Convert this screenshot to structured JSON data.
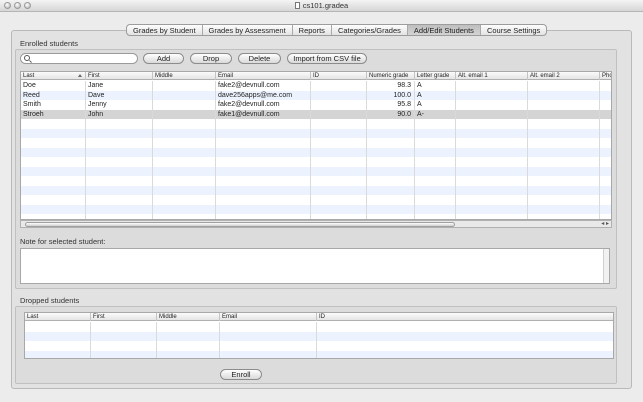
{
  "window": {
    "title": "cs101.gradea"
  },
  "tabs": [
    {
      "label": "Grades by Student",
      "active": false
    },
    {
      "label": "Grades by Assessment",
      "active": false
    },
    {
      "label": "Reports",
      "active": false
    },
    {
      "label": "Categories/Grades",
      "active": false
    },
    {
      "label": "Add/Edit Students",
      "active": true
    },
    {
      "label": "Course Settings",
      "active": false
    }
  ],
  "enrolled": {
    "label": "Enrolled students",
    "search": {
      "value": "",
      "placeholder": ""
    },
    "buttons": {
      "add": "Add",
      "drop": "Drop",
      "delete": "Delete",
      "import": "Import from CSV file"
    },
    "columns": [
      "Last",
      "First",
      "Middle",
      "Email",
      "ID",
      "Numeric grade",
      "Letter grade",
      "Alt. email 1",
      "Alt. email 2",
      "Pho"
    ],
    "rows": [
      {
        "last": "Doe",
        "first": "Jane",
        "middle": "",
        "email": "fake2@devnull.com",
        "id": "",
        "numeric": "98.3",
        "letter": "A",
        "selected": false
      },
      {
        "last": "Reed",
        "first": "Dave",
        "middle": "",
        "email": "dave256apps@me.com",
        "id": "",
        "numeric": "100.0",
        "letter": "A",
        "selected": false
      },
      {
        "last": "Smith",
        "first": "Jenny",
        "middle": "",
        "email": "fake2@devnull.com",
        "id": "",
        "numeric": "95.8",
        "letter": "A",
        "selected": false
      },
      {
        "last": "Stroeh",
        "first": "John",
        "middle": "",
        "email": "fake1@devnull.com",
        "id": "",
        "numeric": "90.0",
        "letter": "A-",
        "selected": true
      }
    ],
    "note_label": "Note for selected student:",
    "note_value": ""
  },
  "dropped": {
    "label": "Dropped students",
    "columns": [
      "Last",
      "First",
      "Middle",
      "Email",
      "ID"
    ],
    "enroll_label": "Enroll"
  }
}
